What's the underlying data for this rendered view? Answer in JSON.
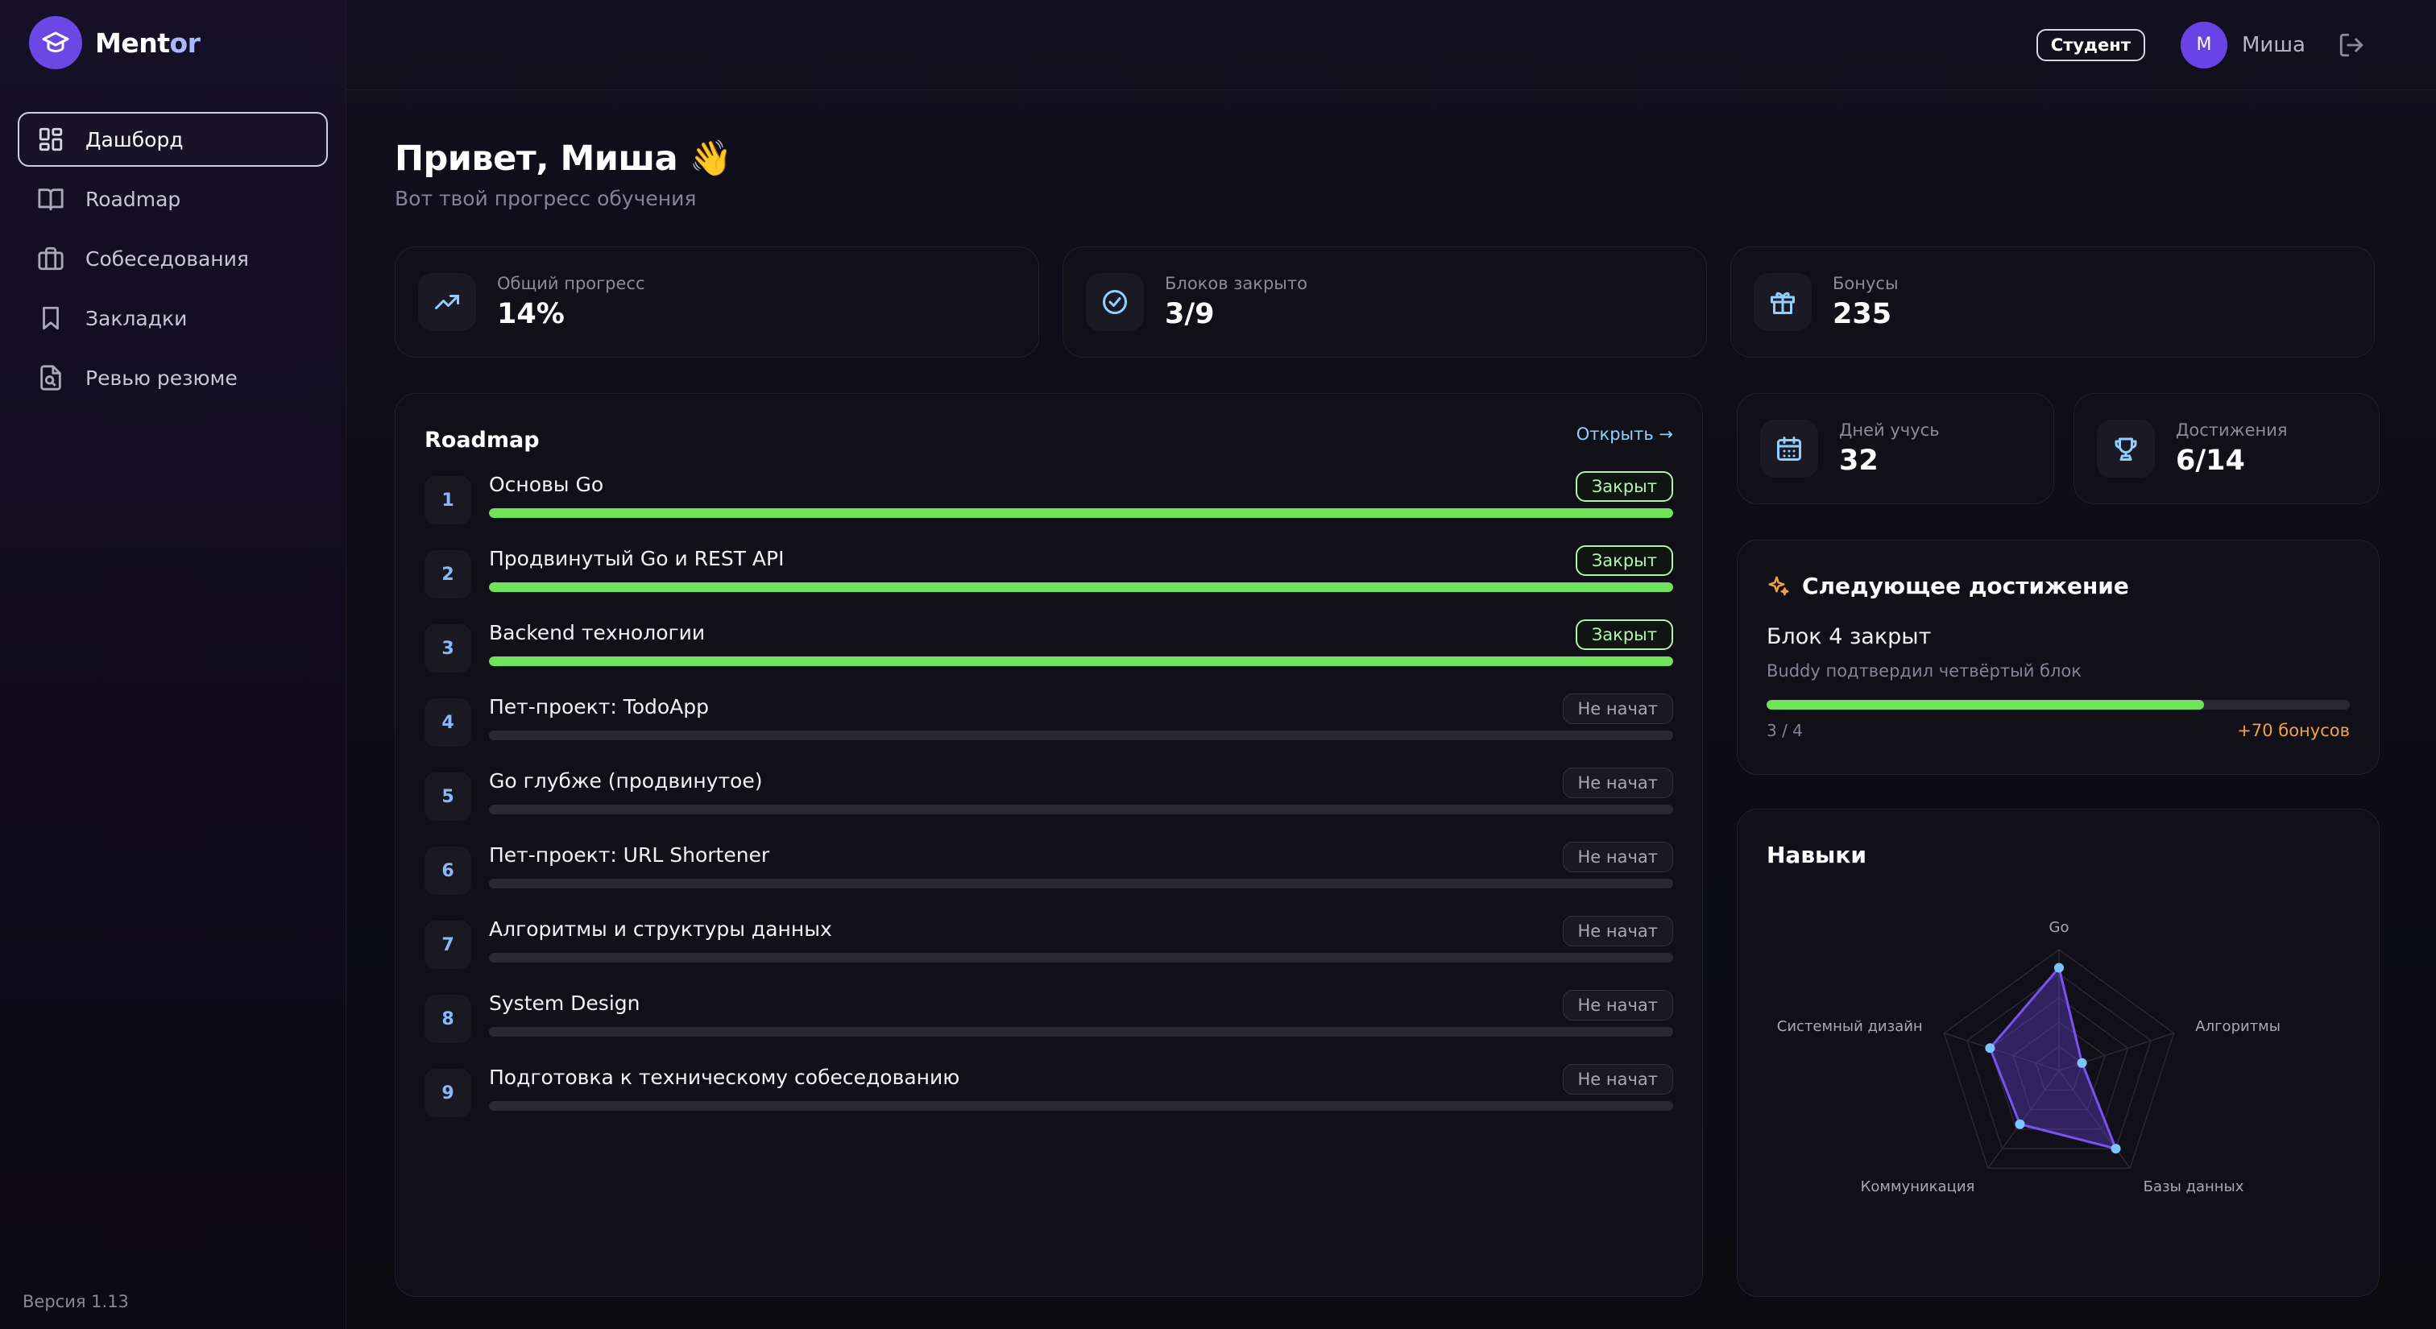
{
  "brand": {
    "name_part1": "Ment",
    "name_part2": "or"
  },
  "sidebar": {
    "items": [
      {
        "label": "Дашборд",
        "active": true
      },
      {
        "label": "Roadmap"
      },
      {
        "label": "Собеседования"
      },
      {
        "label": "Закладки"
      },
      {
        "label": "Ревью резюме"
      }
    ],
    "version": "Версия 1.13"
  },
  "topbar": {
    "role": "Студент",
    "avatar_initial": "М",
    "user_name": "Миша"
  },
  "page": {
    "greeting": "Привет, Миша 👋",
    "subtitle": "Вот твой прогресс обучения"
  },
  "stats": [
    {
      "label": "Общий прогресс",
      "value": "14%"
    },
    {
      "label": "Блоков закрыто",
      "value": "3/9"
    },
    {
      "label": "Бонусы",
      "value": "235"
    },
    {
      "label": "Дней учусь",
      "value": "32"
    },
    {
      "label": "Достижения",
      "value": "6/14"
    }
  ],
  "roadmap": {
    "title": "Roadmap",
    "open_link": "Открыть →",
    "items": [
      {
        "num": "1",
        "title": "Основы Go",
        "status": "Закрыт",
        "done": true,
        "progress": 100
      },
      {
        "num": "2",
        "title": "Продвинутый Go и REST API",
        "status": "Закрыт",
        "done": true,
        "progress": 100
      },
      {
        "num": "3",
        "title": "Backend технологии",
        "status": "Закрыт",
        "done": true,
        "progress": 100
      },
      {
        "num": "4",
        "title": "Пет-проект: TodoApp",
        "status": "Не начат",
        "done": false,
        "progress": 0
      },
      {
        "num": "5",
        "title": "Go глубже (продвинутое)",
        "status": "Не начат",
        "done": false,
        "progress": 0
      },
      {
        "num": "6",
        "title": "Пет-проект: URL Shortener",
        "status": "Не начат",
        "done": false,
        "progress": 0
      },
      {
        "num": "7",
        "title": "Алгоритмы и структуры данных",
        "status": "Не начат",
        "done": false,
        "progress": 0
      },
      {
        "num": "8",
        "title": "System Design",
        "status": "Не начат",
        "done": false,
        "progress": 0
      },
      {
        "num": "9",
        "title": "Подготовка к техническому собеседованию",
        "status": "Не начат",
        "done": false,
        "progress": 0
      }
    ]
  },
  "achievement": {
    "title": "Следующее достижение",
    "name": "Блок 4 закрыт",
    "description": "Buddy подтвердил четвёртый блок",
    "count": "3 / 4",
    "progress": 0.75,
    "reward": "+70 бонусов"
  },
  "skills": {
    "title": "Навыки",
    "axes": [
      {
        "label": "Go",
        "value": 0.85
      },
      {
        "label": "Алгоритмы",
        "value": 0.2
      },
      {
        "label": "Базы данных",
        "value": 0.8
      },
      {
        "label": "Коммуникация",
        "value": 0.55
      },
      {
        "label": "Системный дизайн",
        "value": 0.6
      }
    ]
  },
  "colors": {
    "accent": "#6b47e4",
    "progress_green": "#6fe35a",
    "link_blue": "#8fd0ff",
    "reward_orange": "#f2a24a",
    "radar_point": "#7cc4ff"
  }
}
